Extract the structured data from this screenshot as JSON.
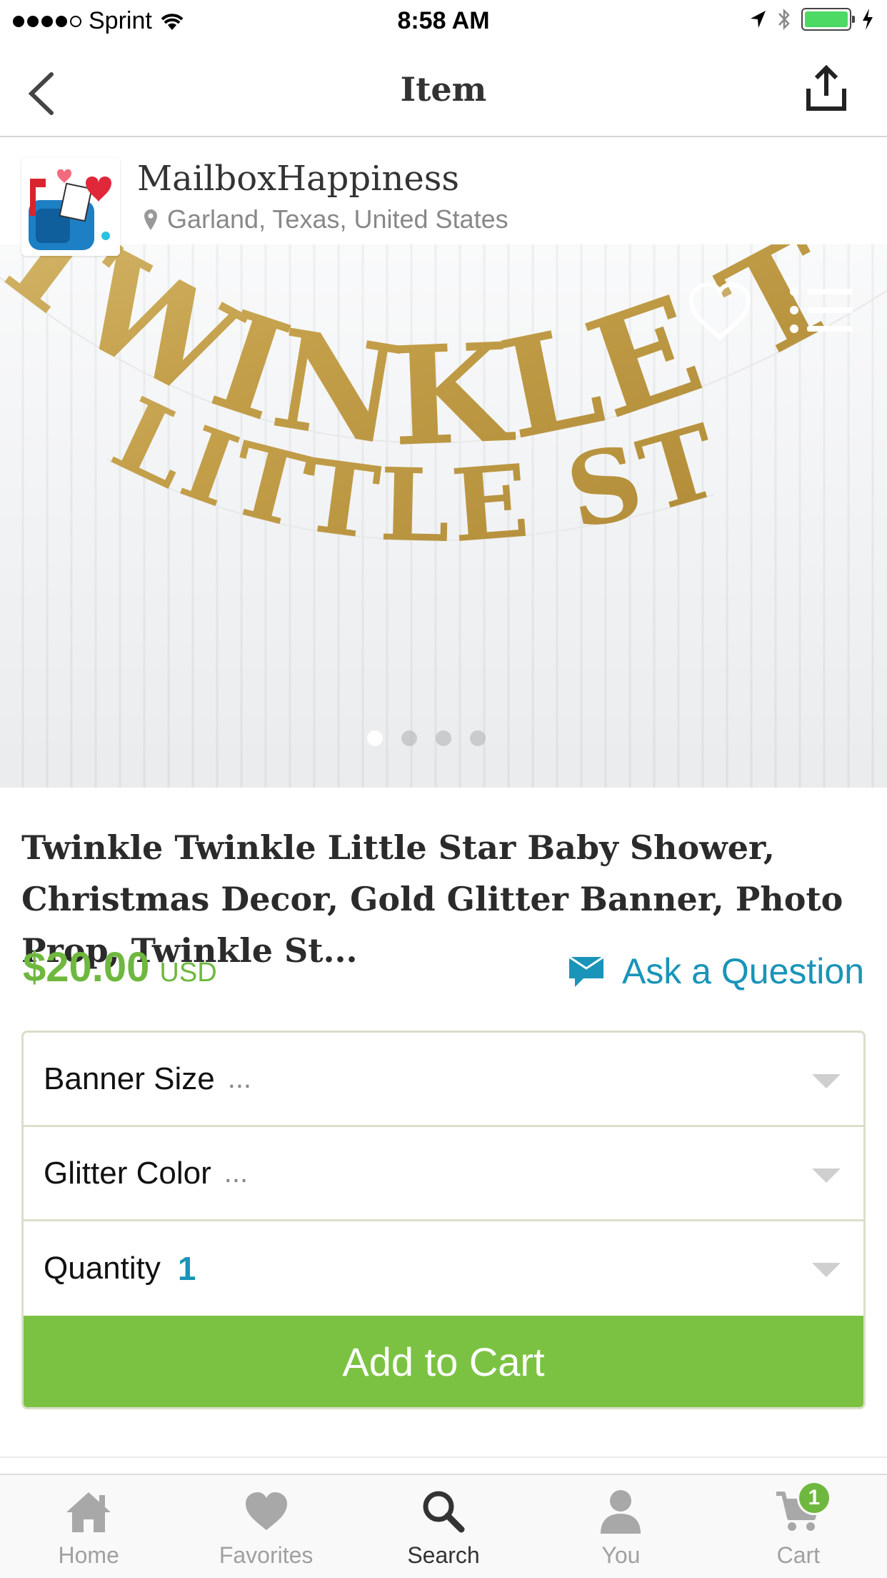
{
  "status_bar": {
    "carrier": "Sprint",
    "time": "8:58 AM"
  },
  "nav": {
    "title": "Item"
  },
  "shop": {
    "name": "MailboxHappiness",
    "location": "Garland, Texas, United States"
  },
  "gallery": {
    "image_count": 4,
    "active_index": 0,
    "banner_line1": "TWINKLE TWINKLE",
    "banner_line2": "LITTLE STAR"
  },
  "product": {
    "title": "Twinkle Twinkle Little Star Baby Shower, Christmas Decor, Gold Glitter Banner, Photo Prop, Twinkle St...",
    "price": "$20.00",
    "currency": "USD",
    "ask_label": "Ask a Question"
  },
  "options": {
    "banner_size_label": "Banner Size",
    "banner_size_value": "...",
    "glitter_color_label": "Glitter Color",
    "glitter_color_value": "...",
    "quantity_label": "Quantity",
    "quantity_value": "1"
  },
  "cart_button": "Add to Cart",
  "tabs": [
    {
      "label": "Home",
      "icon": "home-icon"
    },
    {
      "label": "Favorites",
      "icon": "heart-icon"
    },
    {
      "label": "Search",
      "icon": "search-icon",
      "active": true
    },
    {
      "label": "You",
      "icon": "person-icon"
    },
    {
      "label": "Cart",
      "icon": "cart-icon",
      "badge": "1"
    }
  ],
  "colors": {
    "accent_green": "#7cc242",
    "price_green": "#6fb83f",
    "link_blue": "#1a94b8",
    "glitter_gold": "#c9a64a"
  }
}
